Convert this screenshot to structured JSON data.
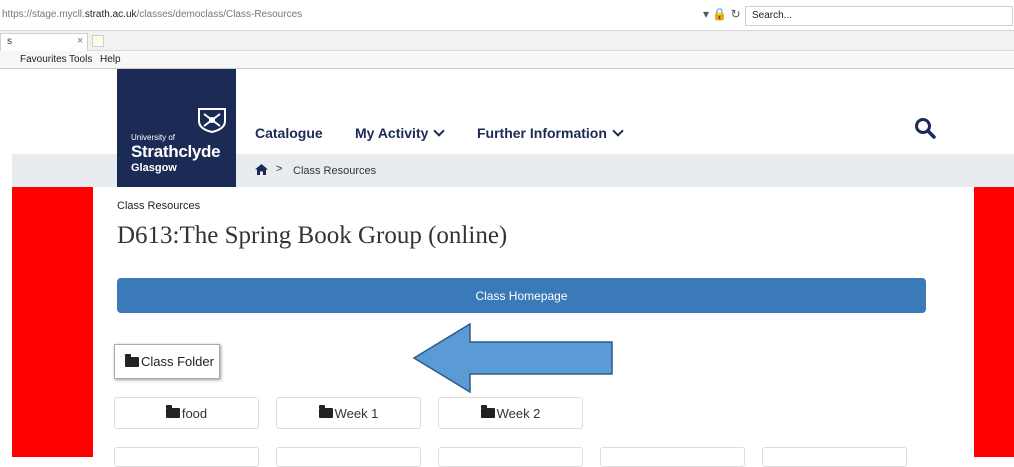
{
  "browser": {
    "url_prefix": "https://stage.mycll.",
    "url_domain": "strath.ac.uk",
    "url_path": "/classes/democlass/Class-Resources",
    "url_controls": "▾ 🔒 ↻",
    "search_placeholder": "Search...",
    "tab_label": "s",
    "tab_close": "×",
    "menu": [
      "Favourites",
      "Tools",
      "Help"
    ]
  },
  "site": {
    "logo_university_of": "University of",
    "logo_strathclyde": "Strathclyde",
    "logo_glasgow": "Glasgow",
    "nav": {
      "catalogue": "Catalogue",
      "my_activity": "My Activity",
      "further_information": "Further Information"
    },
    "breadcrumb_separator": ">",
    "breadcrumb_current": "Class Resources"
  },
  "page": {
    "crumb_label": "Class Resources",
    "title": "D613:The Spring Book Group (online)",
    "homepage_button": "Class Homepage",
    "class_folder": "Class Folder",
    "folders": [
      "food",
      "Week 1",
      "Week 2"
    ]
  },
  "colors": {
    "brand_navy": "#1b2b55",
    "button_blue": "#3a7ab8",
    "annotation_red": "#ff0000",
    "arrow_blue": "#5b9bd5"
  }
}
